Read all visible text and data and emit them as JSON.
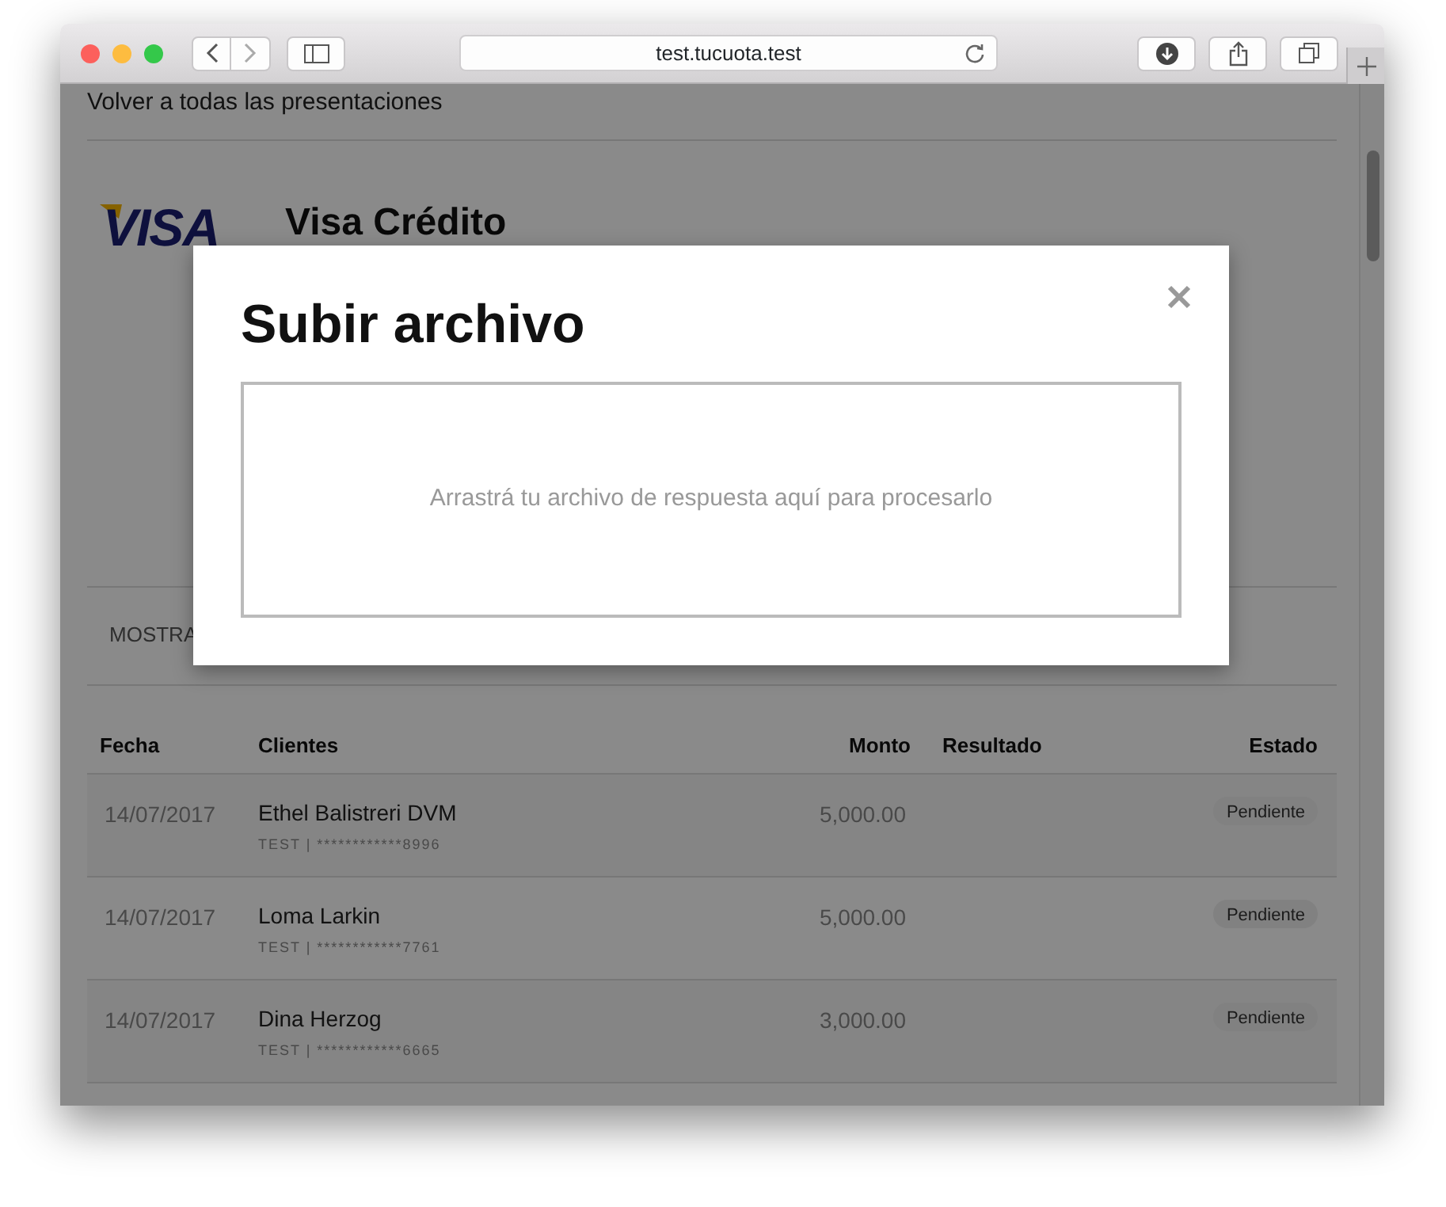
{
  "browser": {
    "url": "test.tucuota.test"
  },
  "page": {
    "back_link": "Volver a todas las presentaciones",
    "logo_text": "VISA",
    "card_brand": "Visa Crédito",
    "filter_label": "MOSTRA",
    "table": {
      "columns": [
        "Fecha",
        "Clientes",
        "Monto",
        "Resultado",
        "Estado"
      ],
      "rows": [
        {
          "date": "14/07/2017",
          "client": "Ethel Balistreri DVM",
          "detail": "TEST | ************8996",
          "amount": "5,000.00",
          "status": "Pendiente"
        },
        {
          "date": "14/07/2017",
          "client": "Loma Larkin",
          "detail": "TEST | ************7761",
          "amount": "5,000.00",
          "status": "Pendiente"
        },
        {
          "date": "14/07/2017",
          "client": "Dina Herzog",
          "detail": "TEST | ************6665",
          "amount": "3,000.00",
          "status": "Pendiente"
        }
      ]
    }
  },
  "modal": {
    "title": "Subir archivo",
    "dropzone": "Arrastrá tu archivo de respuesta aquí para procesarlo"
  }
}
